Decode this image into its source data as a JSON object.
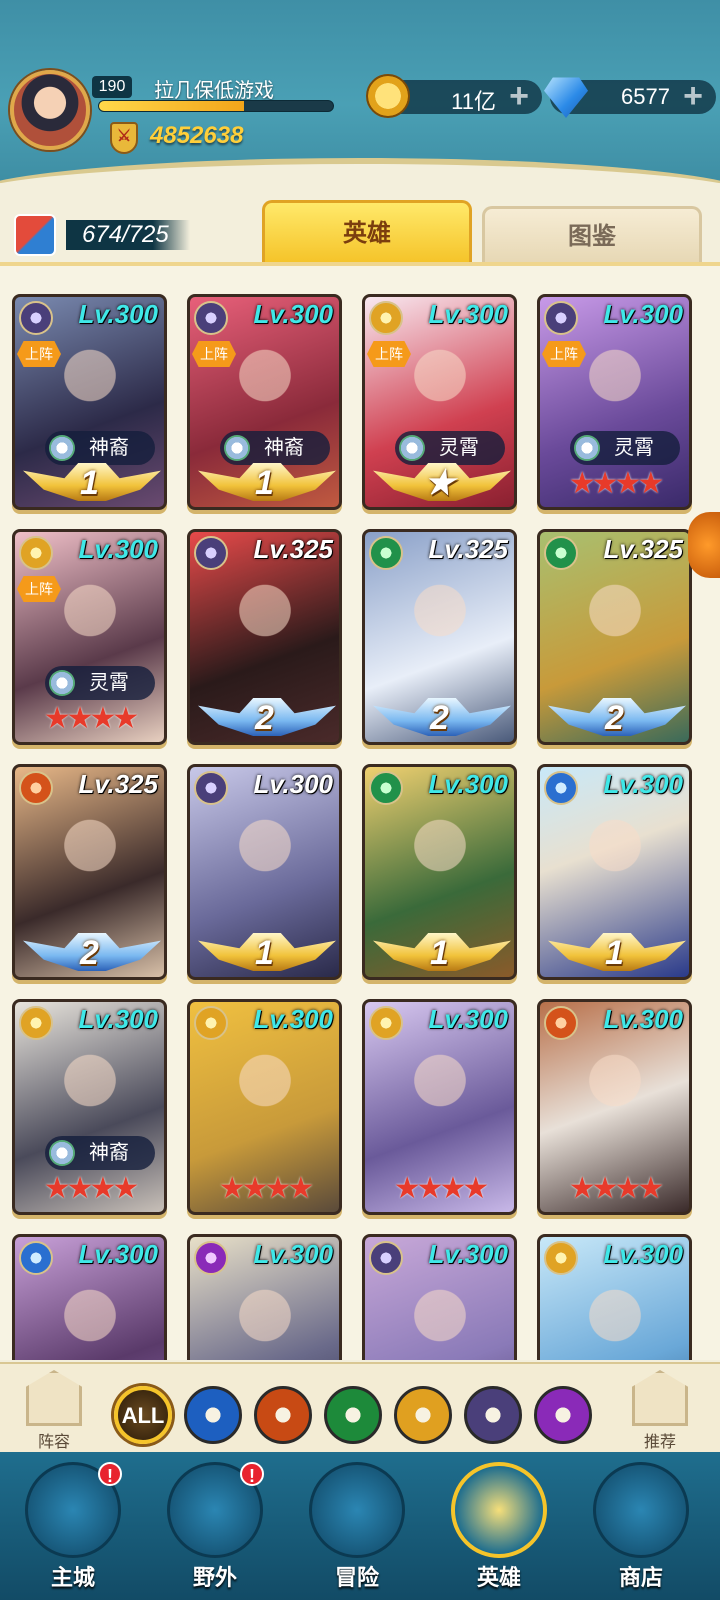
{
  "player": {
    "level": "190",
    "name": "拉几保低游戏",
    "xp_progress": 0.62,
    "power_icon": "shield-icon",
    "power": "4852638"
  },
  "currencies": {
    "gold": {
      "icon": "gold-coin-icon",
      "value": "11亿"
    },
    "gems": {
      "icon": "diamond-icon",
      "value": "6577"
    }
  },
  "collection": {
    "icon": "hero-cards-icon",
    "count": "674/725"
  },
  "tabs": {
    "active": "英雄",
    "inactive": "图鉴"
  },
  "colors": {
    "accent": "#f5c42a",
    "level_cyan": "#3fe8e8",
    "star_red": "#e83a2a"
  },
  "heroes": [
    {
      "lv": "Lv.300",
      "faction": "shadow",
      "deployed": "上阵",
      "rank": "神裔",
      "wings": "1",
      "stars": ""
    },
    {
      "lv": "Lv.300",
      "faction": "shadow",
      "deployed": "上阵",
      "rank": "神裔",
      "wings": "1",
      "stars": ""
    },
    {
      "lv": "Lv.300",
      "faction": "light",
      "deployed": "上阵",
      "rank": "灵霄",
      "wings": "★",
      "stars": ""
    },
    {
      "lv": "Lv.300",
      "faction": "shadow",
      "deployed": "上阵",
      "rank": "灵霄",
      "wings": "",
      "stars": "★★★★"
    },
    {
      "lv": "Lv.300",
      "faction": "light",
      "deployed": "上阵",
      "rank": "灵霄",
      "wings": "",
      "stars": "★★★★"
    },
    {
      "lv": "Lv.325",
      "faction": "shadow",
      "deployed": "",
      "rank": "",
      "wings": "2",
      "stars": ""
    },
    {
      "lv": "Lv.325",
      "faction": "nature",
      "deployed": "",
      "rank": "",
      "wings": "2",
      "stars": ""
    },
    {
      "lv": "Lv.325",
      "faction": "nature",
      "deployed": "",
      "rank": "",
      "wings": "2",
      "stars": ""
    },
    {
      "lv": "Lv.325",
      "faction": "fire",
      "deployed": "",
      "rank": "",
      "wings": "2",
      "stars": ""
    },
    {
      "lv": "Lv.300",
      "faction": "shadow",
      "deployed": "",
      "rank": "",
      "wings": "1",
      "stars": ""
    },
    {
      "lv": "Lv.300",
      "faction": "nature",
      "deployed": "",
      "rank": "",
      "wings": "1",
      "stars": ""
    },
    {
      "lv": "Lv.300",
      "faction": "water",
      "deployed": "",
      "rank": "",
      "wings": "1",
      "stars": ""
    },
    {
      "lv": "Lv.300",
      "faction": "light",
      "deployed": "",
      "rank": "神裔",
      "wings": "",
      "stars": "★★★★"
    },
    {
      "lv": "Lv.300",
      "faction": "light",
      "deployed": "",
      "rank": "",
      "wings": "",
      "stars": "★★★★"
    },
    {
      "lv": "Lv.300",
      "faction": "light",
      "deployed": "",
      "rank": "",
      "wings": "",
      "stars": "★★★★"
    },
    {
      "lv": "Lv.300",
      "faction": "fire",
      "deployed": "",
      "rank": "",
      "wings": "",
      "stars": "★★★★"
    },
    {
      "lv": "Lv.300",
      "faction": "water",
      "deployed": "",
      "rank": "",
      "wings": "",
      "stars": ""
    },
    {
      "lv": "Lv.300",
      "faction": "arcane",
      "deployed": "",
      "rank": "",
      "wings": "",
      "stars": ""
    },
    {
      "lv": "Lv.300",
      "faction": "shadow",
      "deployed": "",
      "rank": "",
      "wings": "",
      "stars": ""
    },
    {
      "lv": "Lv.300",
      "faction": "light",
      "deployed": "",
      "rank": "",
      "wings": "",
      "stars": ""
    }
  ],
  "filters": {
    "lineup_label": "阵容",
    "recommend_label": "推荐",
    "items": [
      {
        "label": "ALL",
        "icon": "all-filter-icon",
        "active": true
      },
      {
        "label": "",
        "icon": "water-faction-icon",
        "active": false
      },
      {
        "label": "",
        "icon": "fire-faction-icon",
        "active": false
      },
      {
        "label": "",
        "icon": "nature-faction-icon",
        "active": false
      },
      {
        "label": "",
        "icon": "light-faction-icon",
        "active": false
      },
      {
        "label": "",
        "icon": "shadow-faction-icon",
        "active": false
      },
      {
        "label": "",
        "icon": "arcane-faction-icon",
        "active": false
      }
    ]
  },
  "nav": [
    {
      "label": "主城",
      "icon": "castle-icon",
      "alert": "!"
    },
    {
      "label": "野外",
      "icon": "wilds-icon",
      "alert": "!"
    },
    {
      "label": "冒险",
      "icon": "sword-icon",
      "alert": ""
    },
    {
      "label": "英雄",
      "icon": "helmet-icon",
      "alert": ""
    },
    {
      "label": "商店",
      "icon": "shop-icon",
      "alert": ""
    }
  ]
}
